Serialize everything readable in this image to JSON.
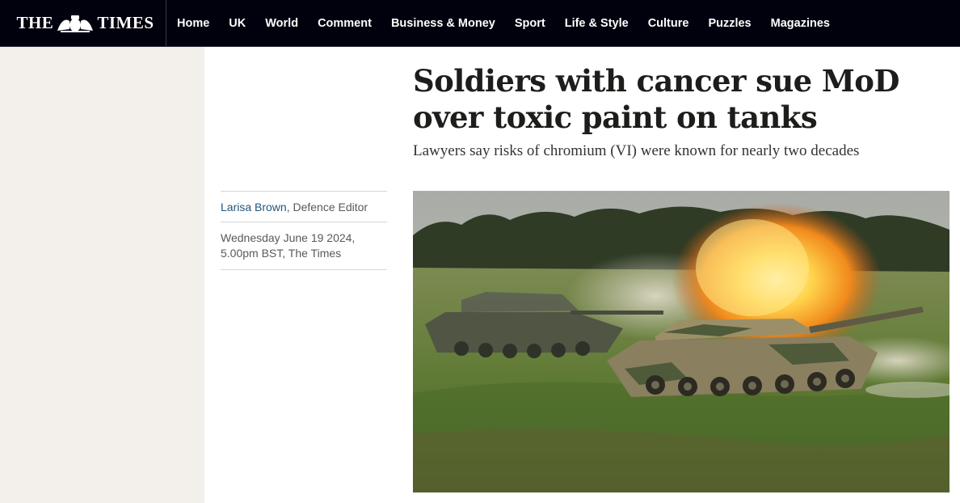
{
  "masthead": {
    "logo_left": "THE",
    "logo_right": "TIMES"
  },
  "nav": {
    "items": [
      {
        "label": "Home"
      },
      {
        "label": "UK"
      },
      {
        "label": "World"
      },
      {
        "label": "Comment"
      },
      {
        "label": "Business & Money"
      },
      {
        "label": "Sport"
      },
      {
        "label": "Life & Style"
      },
      {
        "label": "Culture"
      },
      {
        "label": "Puzzles"
      },
      {
        "label": "Magazines"
      }
    ]
  },
  "article": {
    "headline": "Soldiers with cancer sue MoD over toxic paint on tanks",
    "standfirst": "Lawyers say risks of chromium (VI) were known for nearly two decades",
    "author": "Larisa Brown",
    "author_role": ", Defence Editor",
    "date_line1": "Wednesday June 19 2024,",
    "date_line2": "5.00pm BST, The Times"
  },
  "colors": {
    "masthead_bg": "#01000d",
    "left_pane_bg": "#f3efea",
    "author_link": "#24557a"
  }
}
